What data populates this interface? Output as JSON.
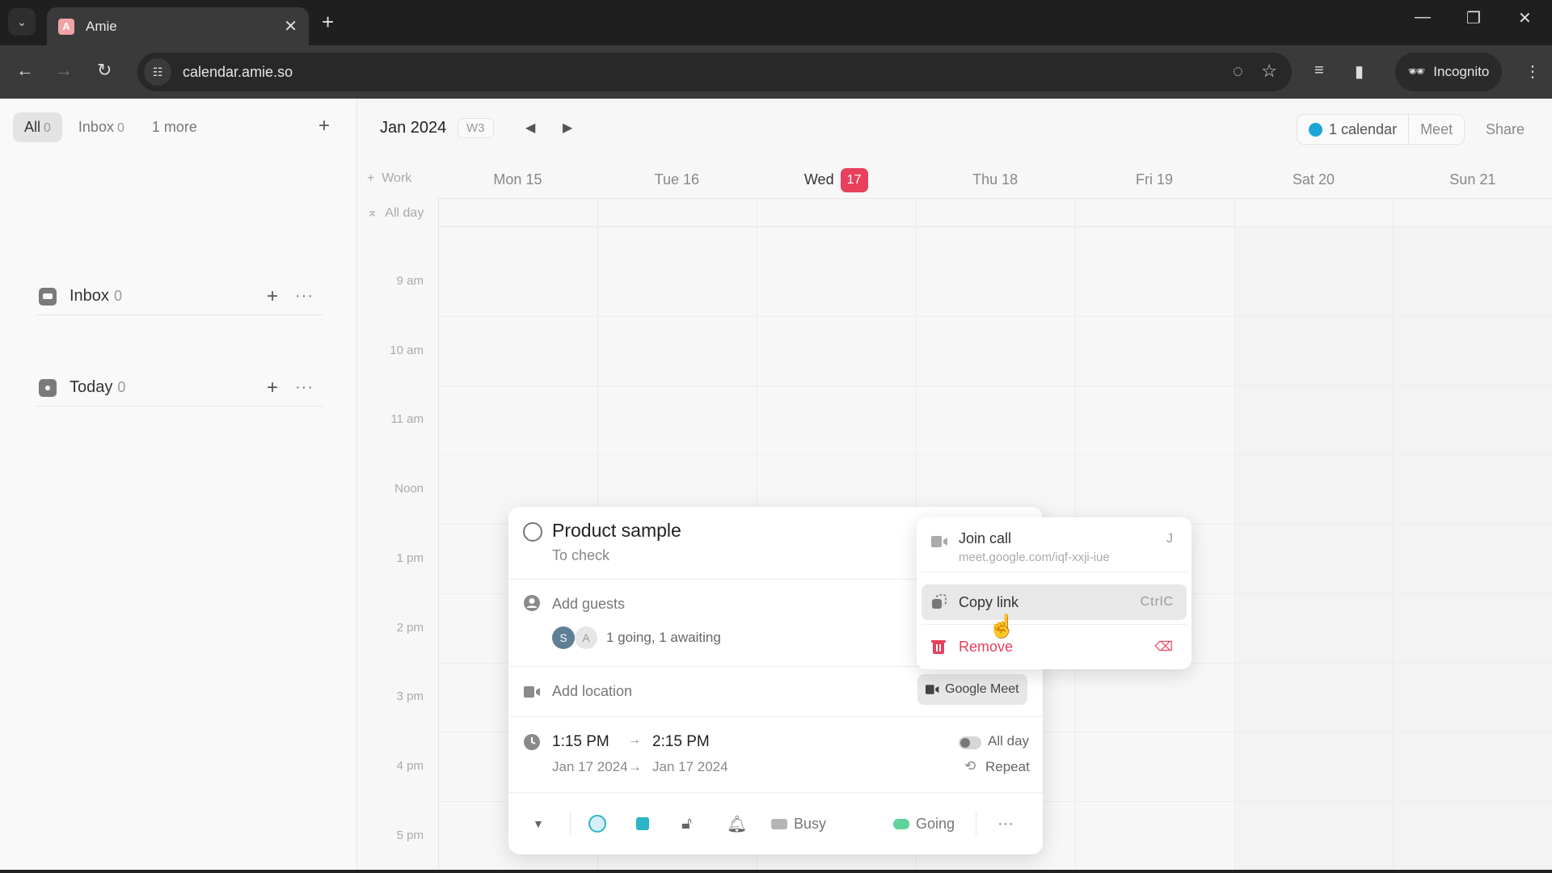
{
  "browser": {
    "tab_title": "Amie",
    "tab_favicon_letter": "A",
    "url": "calendar.amie.so",
    "incognito_label": "Incognito"
  },
  "sidebar": {
    "filter_tabs": [
      {
        "label": "All",
        "count": "0",
        "active": true
      },
      {
        "label": "Inbox",
        "count": "0",
        "active": false
      },
      {
        "label": "1 more",
        "count": "",
        "active": false
      }
    ],
    "sections": [
      {
        "title": "Inbox",
        "count": "0",
        "icon": "inbox-icon"
      },
      {
        "title": "Today",
        "count": "0",
        "icon": "today-icon"
      }
    ]
  },
  "calendar": {
    "month": "Jan 2024",
    "week": "W3",
    "calendars_label": "1 calendar",
    "calendar_color": "#1aa7d6",
    "meet_label": "Meet",
    "share_label": "Share",
    "work_label": "Work",
    "allday_label": "All day",
    "days": [
      {
        "name": "Mon",
        "date": "15",
        "today": false
      },
      {
        "name": "Tue",
        "date": "16",
        "today": false
      },
      {
        "name": "Wed",
        "date": "17",
        "today": true
      },
      {
        "name": "Thu",
        "date": "18",
        "today": false
      },
      {
        "name": "Fri",
        "date": "19",
        "today": false
      },
      {
        "name": "Sat",
        "date": "20",
        "today": false
      },
      {
        "name": "Sun",
        "date": "21",
        "today": false
      }
    ],
    "today_color": "#e8405d",
    "hours": [
      "9 am",
      "10 am",
      "11 am",
      "Noon",
      "1 pm",
      "2 pm",
      "3 pm",
      "4 pm",
      "5 pm"
    ]
  },
  "event_popup": {
    "title": "Product sample",
    "subtitle": "To check",
    "add_guests": "Add guests",
    "guests": [
      {
        "initial": "S"
      },
      {
        "initial": "A"
      }
    ],
    "guest_status": "1 going, 1 awaiting",
    "add_location": "Add location",
    "location_button": "Google Meet",
    "start_time": "1:15 PM",
    "end_time": "2:15 PM",
    "start_date": "Jan 17 2024",
    "end_date": "Jan 17 2024",
    "allday_label": "All day",
    "allday_on": false,
    "repeat_label": "Repeat",
    "busy_label": "Busy",
    "going_label": "Going",
    "going_color": "#5fd39a"
  },
  "context_menu": {
    "items": [
      {
        "label": "Join call",
        "sublabel": "meet.google.com/iqf-xxji-iue",
        "shortcut": "J"
      },
      {
        "label": "Copy link",
        "shortcut": "CtrlC",
        "highlighted": true
      },
      {
        "label": "Remove",
        "shortcut": "⌫",
        "danger": true
      }
    ],
    "danger_color": "#e8405d"
  }
}
